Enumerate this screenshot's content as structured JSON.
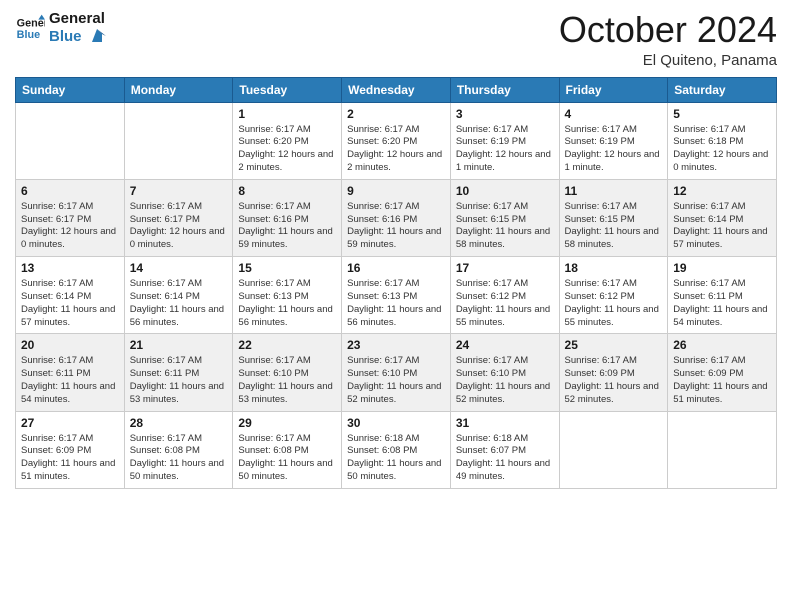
{
  "logo": {
    "line1": "General",
    "line2": "Blue"
  },
  "title": "October 2024",
  "subtitle": "El Quiteno, Panama",
  "days": [
    "Sunday",
    "Monday",
    "Tuesday",
    "Wednesday",
    "Thursday",
    "Friday",
    "Saturday"
  ],
  "weeks": [
    [
      {
        "num": "",
        "info": ""
      },
      {
        "num": "",
        "info": ""
      },
      {
        "num": "1",
        "info": "Sunrise: 6:17 AM\nSunset: 6:20 PM\nDaylight: 12 hours and 2 minutes."
      },
      {
        "num": "2",
        "info": "Sunrise: 6:17 AM\nSunset: 6:20 PM\nDaylight: 12 hours and 2 minutes."
      },
      {
        "num": "3",
        "info": "Sunrise: 6:17 AM\nSunset: 6:19 PM\nDaylight: 12 hours and 1 minute."
      },
      {
        "num": "4",
        "info": "Sunrise: 6:17 AM\nSunset: 6:19 PM\nDaylight: 12 hours and 1 minute."
      },
      {
        "num": "5",
        "info": "Sunrise: 6:17 AM\nSunset: 6:18 PM\nDaylight: 12 hours and 0 minutes."
      }
    ],
    [
      {
        "num": "6",
        "info": "Sunrise: 6:17 AM\nSunset: 6:17 PM\nDaylight: 12 hours and 0 minutes."
      },
      {
        "num": "7",
        "info": "Sunrise: 6:17 AM\nSunset: 6:17 PM\nDaylight: 12 hours and 0 minutes."
      },
      {
        "num": "8",
        "info": "Sunrise: 6:17 AM\nSunset: 6:16 PM\nDaylight: 11 hours and 59 minutes."
      },
      {
        "num": "9",
        "info": "Sunrise: 6:17 AM\nSunset: 6:16 PM\nDaylight: 11 hours and 59 minutes."
      },
      {
        "num": "10",
        "info": "Sunrise: 6:17 AM\nSunset: 6:15 PM\nDaylight: 11 hours and 58 minutes."
      },
      {
        "num": "11",
        "info": "Sunrise: 6:17 AM\nSunset: 6:15 PM\nDaylight: 11 hours and 58 minutes."
      },
      {
        "num": "12",
        "info": "Sunrise: 6:17 AM\nSunset: 6:14 PM\nDaylight: 11 hours and 57 minutes."
      }
    ],
    [
      {
        "num": "13",
        "info": "Sunrise: 6:17 AM\nSunset: 6:14 PM\nDaylight: 11 hours and 57 minutes."
      },
      {
        "num": "14",
        "info": "Sunrise: 6:17 AM\nSunset: 6:14 PM\nDaylight: 11 hours and 56 minutes."
      },
      {
        "num": "15",
        "info": "Sunrise: 6:17 AM\nSunset: 6:13 PM\nDaylight: 11 hours and 56 minutes."
      },
      {
        "num": "16",
        "info": "Sunrise: 6:17 AM\nSunset: 6:13 PM\nDaylight: 11 hours and 56 minutes."
      },
      {
        "num": "17",
        "info": "Sunrise: 6:17 AM\nSunset: 6:12 PM\nDaylight: 11 hours and 55 minutes."
      },
      {
        "num": "18",
        "info": "Sunrise: 6:17 AM\nSunset: 6:12 PM\nDaylight: 11 hours and 55 minutes."
      },
      {
        "num": "19",
        "info": "Sunrise: 6:17 AM\nSunset: 6:11 PM\nDaylight: 11 hours and 54 minutes."
      }
    ],
    [
      {
        "num": "20",
        "info": "Sunrise: 6:17 AM\nSunset: 6:11 PM\nDaylight: 11 hours and 54 minutes."
      },
      {
        "num": "21",
        "info": "Sunrise: 6:17 AM\nSunset: 6:11 PM\nDaylight: 11 hours and 53 minutes."
      },
      {
        "num": "22",
        "info": "Sunrise: 6:17 AM\nSunset: 6:10 PM\nDaylight: 11 hours and 53 minutes."
      },
      {
        "num": "23",
        "info": "Sunrise: 6:17 AM\nSunset: 6:10 PM\nDaylight: 11 hours and 52 minutes."
      },
      {
        "num": "24",
        "info": "Sunrise: 6:17 AM\nSunset: 6:10 PM\nDaylight: 11 hours and 52 minutes."
      },
      {
        "num": "25",
        "info": "Sunrise: 6:17 AM\nSunset: 6:09 PM\nDaylight: 11 hours and 52 minutes."
      },
      {
        "num": "26",
        "info": "Sunrise: 6:17 AM\nSunset: 6:09 PM\nDaylight: 11 hours and 51 minutes."
      }
    ],
    [
      {
        "num": "27",
        "info": "Sunrise: 6:17 AM\nSunset: 6:09 PM\nDaylight: 11 hours and 51 minutes."
      },
      {
        "num": "28",
        "info": "Sunrise: 6:17 AM\nSunset: 6:08 PM\nDaylight: 11 hours and 50 minutes."
      },
      {
        "num": "29",
        "info": "Sunrise: 6:17 AM\nSunset: 6:08 PM\nDaylight: 11 hours and 50 minutes."
      },
      {
        "num": "30",
        "info": "Sunrise: 6:18 AM\nSunset: 6:08 PM\nDaylight: 11 hours and 50 minutes."
      },
      {
        "num": "31",
        "info": "Sunrise: 6:18 AM\nSunset: 6:07 PM\nDaylight: 11 hours and 49 minutes."
      },
      {
        "num": "",
        "info": ""
      },
      {
        "num": "",
        "info": ""
      }
    ]
  ]
}
